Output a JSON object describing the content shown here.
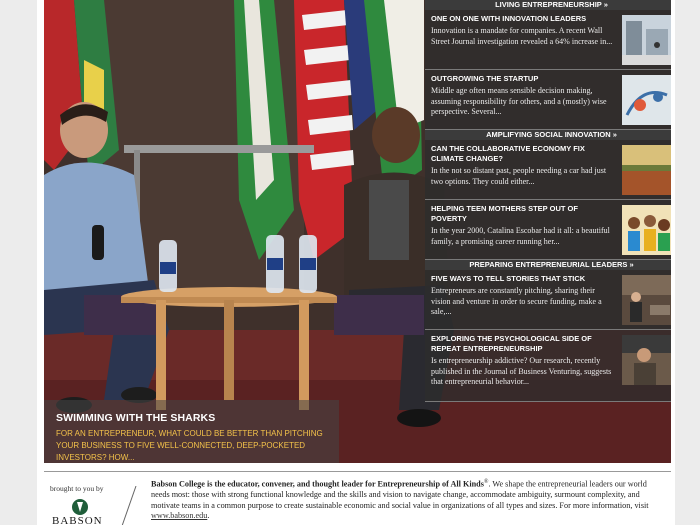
{
  "caption": {
    "title": "Swimming with the Sharks",
    "text": "For an entrepreneur, what could be better than pitching your business to five well-connected, deep-pocketed investors? How..."
  },
  "sections": [
    {
      "header": "Living Entrepreneurship »",
      "stories": [
        {
          "title": "One on One with Innovation Leaders",
          "body": "Innovation is a mandate for companies. A recent Wall Street Journal investigation revealed a 64% increase in...",
          "thumb_icon": "office-building-photo"
        },
        {
          "title": "Outgrowing the Startup",
          "body": "Middle age often means sensible decision making, assuming responsibility for others, and a (mostly) wise perspective. Several...",
          "thumb_icon": "growth-illustration-photo"
        }
      ]
    },
    {
      "header": "Amplifying Social Innovation »",
      "stories": [
        {
          "title": "Can the Collaborative Economy Fix Climate Change?",
          "body": "In the not so distant past, people needing a car had just two options. They could either...",
          "thumb_icon": "landscape-photo"
        },
        {
          "title": "Helping Teen Mothers Step out of Poverty",
          "body": "In the year 2000, Catalina Escobar had it all: a beautiful family, a promising career running her...",
          "thumb_icon": "children-group-photo"
        }
      ]
    },
    {
      "header": "Preparing Entrepreneurial Leaders »",
      "stories": [
        {
          "title": "Five Ways to Tell Stories that Stick",
          "body": "Entrepreneurs are constantly pitching, sharing their vision and venture in order to secure funding, make a sale,...",
          "thumb_icon": "speaker-photo"
        },
        {
          "title": "Exploring the Psychological Side of Repeat Entrepreneurship",
          "body": "Is entrepreneurship addictive? Our research, recently published in the Journal of Business Venturing, suggests that entrepreneurial behavior...",
          "thumb_icon": "person-portrait-photo"
        }
      ]
    }
  ],
  "footer": {
    "brought_by": "brought to you by",
    "logo_text": "BABSON",
    "lead": "Babson College is the educator, convener, and thought leader for Entrepreneurship of All Kinds",
    "reg": "®",
    "body": ". We shape the entrepreneurial leaders our world needs most: those with strong functional knowledge and the skills and vision to navigate change, accommodate ambiguity, surmount complexity, and motivate teams in a common purpose to create sustainable economic and social value in organizations of all types and sizes. For more information, visit ",
    "link": "www.babson.edu",
    "end": "."
  },
  "colors": {
    "caption_accent": "#f3c24a",
    "panel_bg": "#2d2d2d",
    "header_bg": "#3b3b3b"
  }
}
